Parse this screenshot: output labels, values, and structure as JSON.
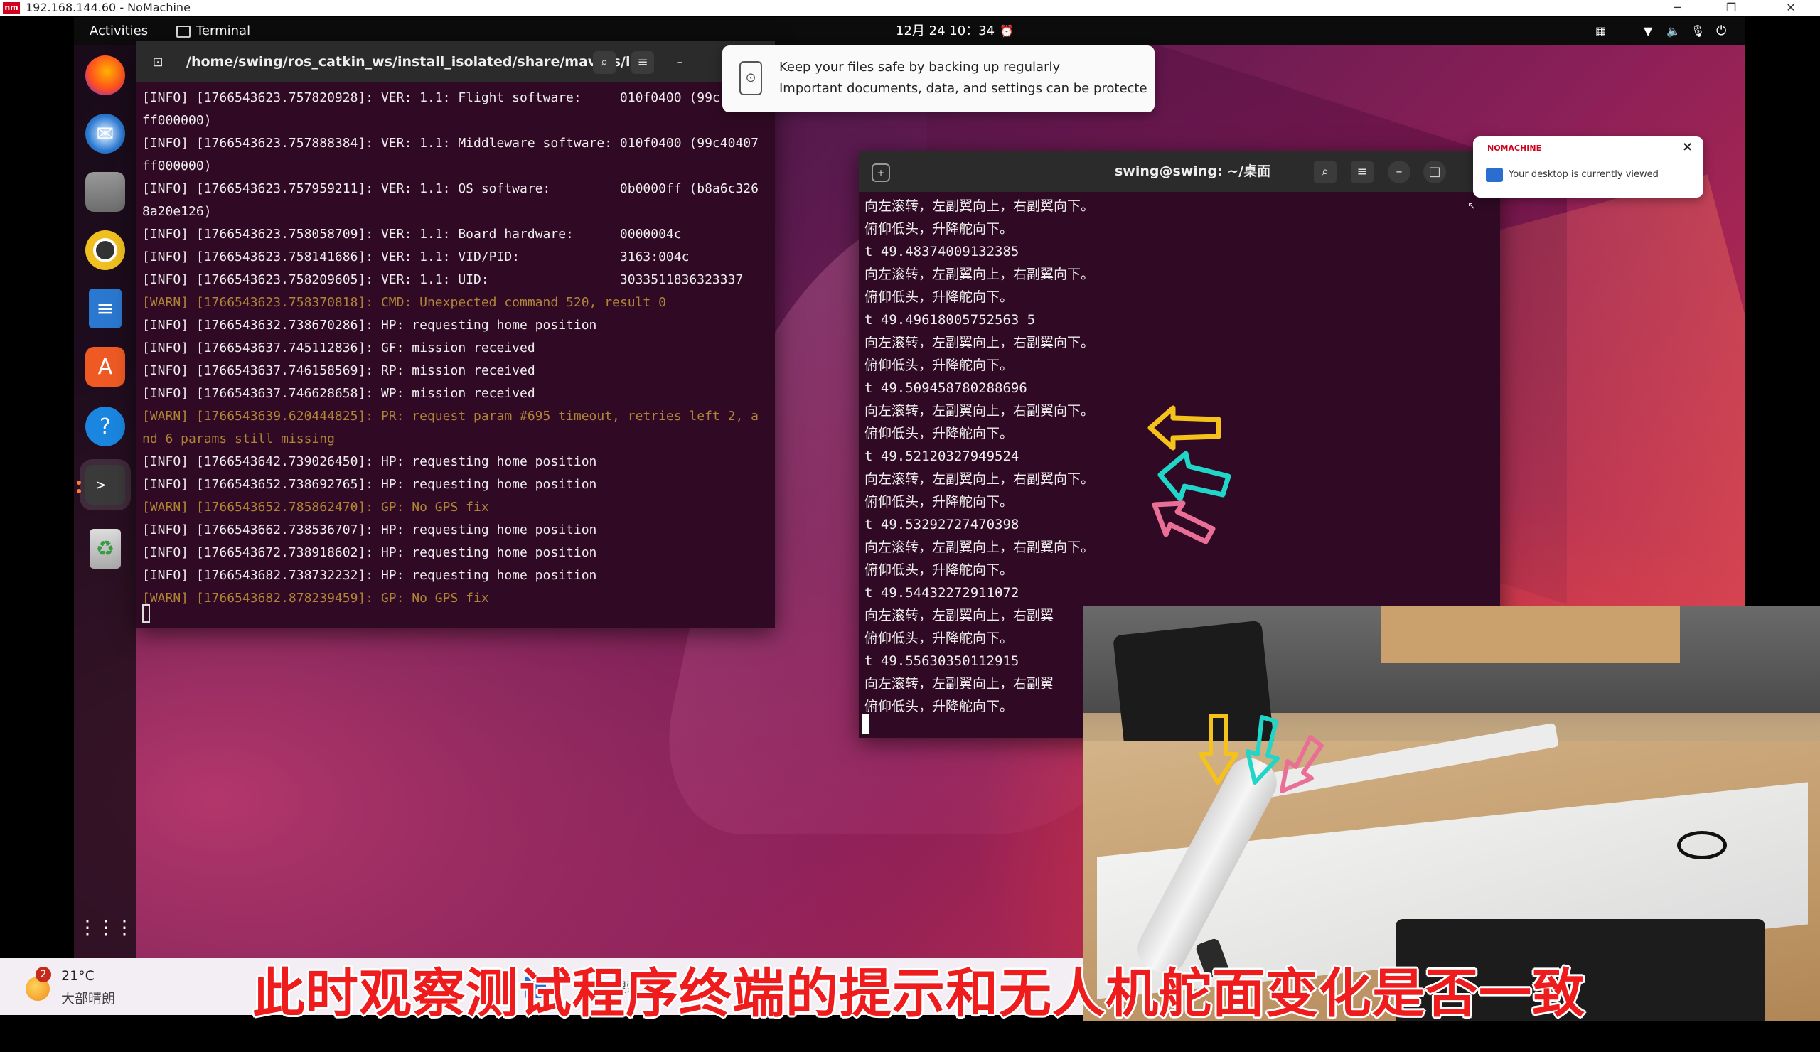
{
  "nomachine": {
    "logo_text": "nm",
    "title": "192.168.144.60 - NoMachine",
    "min": "─",
    "restore": "❐",
    "close": "✕"
  },
  "topbar": {
    "activities": "Activities",
    "app_name": "Terminal",
    "clock": "12月 24  10：34",
    "status_icons": [
      "network-icon",
      "wifi-icon",
      "volume-icon",
      "mic-icon",
      "power-icon"
    ]
  },
  "dock": {
    "items": [
      "firefox-icon",
      "thunderbird-icon",
      "files-icon",
      "rhythmbox-icon",
      "writer-icon",
      "app-center-icon",
      "help-icon",
      "terminal-icon",
      "trash-icon"
    ],
    "apps_grid": "show-apps-icon"
  },
  "terminal1": {
    "title": "/home/swing/ros_catkin_ws/install_isolated/share/mavros/l...",
    "lines": [
      {
        "t": "[INFO] [1766543623.757820928]: VER: 1.1: Flight software:     010f0400 (99c",
        "warn": false
      },
      {
        "t": "ff000000)",
        "warn": false
      },
      {
        "t": "[INFO] [1766543623.757888384]: VER: 1.1: Middleware software: 010f0400 (99c40407",
        "warn": false
      },
      {
        "t": "ff000000)",
        "warn": false
      },
      {
        "t": "[INFO] [1766543623.757959211]: VER: 1.1: OS software:         0b0000ff (b8a6c326",
        "warn": false
      },
      {
        "t": "8a20e126)",
        "warn": false
      },
      {
        "t": "[INFO] [1766543623.758058709]: VER: 1.1: Board hardware:      0000004c",
        "warn": false
      },
      {
        "t": "[INFO] [1766543623.758141686]: VER: 1.1: VID/PID:             3163:004c",
        "warn": false
      },
      {
        "t": "[INFO] [1766543623.758209605]: VER: 1.1: UID:                 3033511836323337",
        "warn": false
      },
      {
        "t": "[WARN] [1766543623.758370818]: CMD: Unexpected command 520, result 0",
        "warn": true
      },
      {
        "t": "[INFO] [1766543632.738670286]: HP: requesting home position",
        "warn": false
      },
      {
        "t": "[INFO] [1766543637.745112836]: GF: mission received",
        "warn": false
      },
      {
        "t": "[INFO] [1766543637.746158569]: RP: mission received",
        "warn": false
      },
      {
        "t": "[INFO] [1766543637.746628658]: WP: mission received",
        "warn": false
      },
      {
        "t": "[WARN] [1766543639.620444825]: PR: request param #695 timeout, retries left 2, a",
        "warn": true
      },
      {
        "t": "nd 6 params still missing",
        "warn": true
      },
      {
        "t": "[INFO] [1766543642.739026450]: HP: requesting home position",
        "warn": false
      },
      {
        "t": "[INFO] [1766543652.738692765]: HP: requesting home position",
        "warn": false
      },
      {
        "t": "[WARN] [1766543652.785862470]: GP: No GPS fix",
        "warn": true
      },
      {
        "t": "[INFO] [1766543662.738536707]: HP: requesting home position",
        "warn": false
      },
      {
        "t": "[INFO] [1766543672.738918602]: HP: requesting home position",
        "warn": false
      },
      {
        "t": "[INFO] [1766543682.738732232]: HP: requesting home position",
        "warn": false
      },
      {
        "t": "[WARN] [1766543682.878239459]: GP: No GPS fix",
        "warn": true
      }
    ]
  },
  "terminal2": {
    "title": "swing@swing: ~/桌面",
    "lines": [
      "向左滚转，左副翼向上，右副翼向下。",
      "俯仰低头，升降舵向下。",
      "t 49.48374009132385",
      "向左滚转，左副翼向上，右副翼向下。",
      "俯仰低头，升降舵向下。",
      "t 49.49618005752563 5",
      "向左滚转，左副翼向上，右副翼向下。",
      "俯仰低头，升降舵向下。",
      "t 49.509458780288696",
      "向左滚转，左副翼向上，右副翼向下。",
      "俯仰低头，升降舵向下。",
      "t 49.52120327949524",
      "向左滚转，左副翼向上，右副翼向下。",
      "俯仰低头，升降舵向下。",
      "t 49.53292727470398",
      "向左滚转，左副翼向上，右副翼向下。",
      "俯仰低头，升降舵向下。",
      "t 49.54432272911072",
      "向左滚转，左副翼向上，右副翼",
      "俯仰低头，升降舵向下。",
      "t 49.55630350112915",
      "向左滚转，左副翼向上，右副翼",
      "俯仰低头，升降舵向下。"
    ]
  },
  "notification": {
    "title": "Keep your files safe by backing up regularly",
    "body": "Important documents, data, and settings can be protected by..."
  },
  "nomachine_popup": {
    "brand": "NOMACHINE",
    "message": "Your desktop is currently viewed",
    "close": "×"
  },
  "taskbar": {
    "weather_badge": "2",
    "temperature": "21°C",
    "condition": "大部晴朗",
    "search": "搜索"
  },
  "caption": "此时观察测试程序终端的提示和无人机舵面变化是否一致",
  "colors": {
    "arrow_yellow": "#f5c21b",
    "arrow_cyan": "#1fd6c8",
    "arrow_pink": "#ea6f96",
    "caption_red": "#ee1c1c",
    "terminal_bg": "#300a24"
  }
}
